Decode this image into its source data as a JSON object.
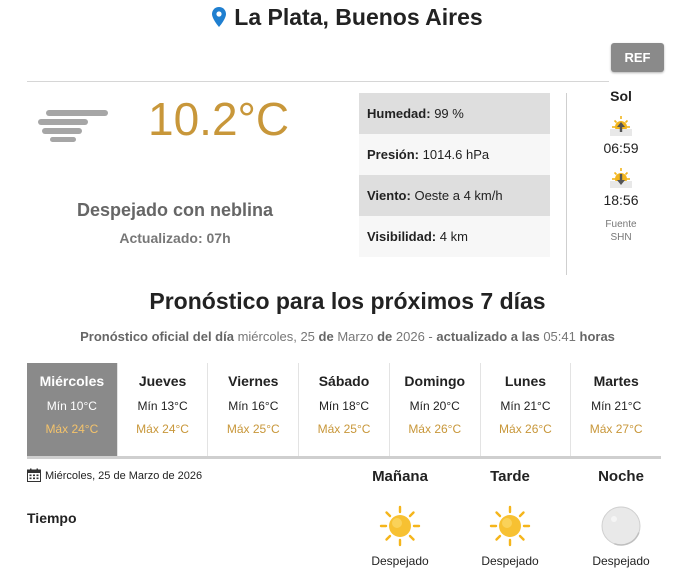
{
  "location": {
    "name": "La Plata, Buenos Aires"
  },
  "ref_button": "REF",
  "current": {
    "temperature": "10.2°C",
    "condition": "Despejado con neblina",
    "updated": "Actualizado: 07h",
    "icon": "fog-icon"
  },
  "details": [
    {
      "key": "Humedad:",
      "value": "99 %"
    },
    {
      "key": "Presión:",
      "value": "1014.6 hPa"
    },
    {
      "key": "Viento:",
      "value": "Oeste a 4 km/h"
    },
    {
      "key": "Visibilidad:",
      "value": "4 km"
    }
  ],
  "sun": {
    "title": "Sol",
    "sunrise": "06:59",
    "sunset": "18:56",
    "source_label": "Fuente",
    "source": "SHN"
  },
  "forecast": {
    "title": "Pronóstico para los próximos 7 días",
    "subtitle": {
      "p1": "Pronóstico oficial del día",
      "p2": "miércoles, 25",
      "p3": "de",
      "p4": "Marzo",
      "p5": "de",
      "p6": "2026 -",
      "p7": "actualizado a las",
      "p8": "05:41",
      "p9": "horas"
    },
    "days": [
      {
        "name": "Miércoles",
        "min": "Mín 10°C",
        "max": "Máx 24°C"
      },
      {
        "name": "Jueves",
        "min": "Mín 13°C",
        "max": "Máx 24°C"
      },
      {
        "name": "Viernes",
        "min": "Mín 16°C",
        "max": "Máx 25°C"
      },
      {
        "name": "Sábado",
        "min": "Mín 18°C",
        "max": "Máx 25°C"
      },
      {
        "name": "Domingo",
        "min": "Mín 20°C",
        "max": "Máx 26°C"
      },
      {
        "name": "Lunes",
        "min": "Mín 21°C",
        "max": "Máx 26°C"
      },
      {
        "name": "Martes",
        "min": "Mín 21°C",
        "max": "Máx 27°C"
      }
    ]
  },
  "detail_day": {
    "date": "Miércoles, 25 de Marzo de 2026",
    "row_label": "Tiempo",
    "periods": [
      {
        "name": "Mañana",
        "condition": "Despejado",
        "icon": "sun-icon"
      },
      {
        "name": "Tarde",
        "condition": "Despejado",
        "icon": "sun-icon"
      },
      {
        "name": "Noche",
        "condition": "Despejado",
        "icon": "moon-icon"
      }
    ]
  },
  "colors": {
    "accent": "#c8973a",
    "active_day": "#8a8a8a",
    "pin": "#1f7fd0"
  }
}
